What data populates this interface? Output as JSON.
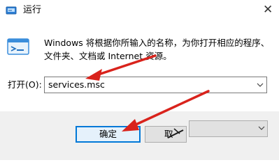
{
  "window": {
    "title": "运行",
    "close_glyph": "✕"
  },
  "description": "Windows 将根据你所输入的名称，为你打开相应的程序、\n文件夹、文档或 Internet 资源。",
  "open": {
    "label": "打开(O):",
    "value": "services.msc"
  },
  "buttons": {
    "ok": "确定",
    "cancel": "取"
  },
  "icons": {
    "app": "run-app-icon",
    "run": "run-window-icon",
    "close": "close-icon",
    "dropdown": "chevron-down-icon"
  },
  "colors": {
    "annotation_arrow": "#d9231c",
    "focus_border": "#0078d7"
  }
}
